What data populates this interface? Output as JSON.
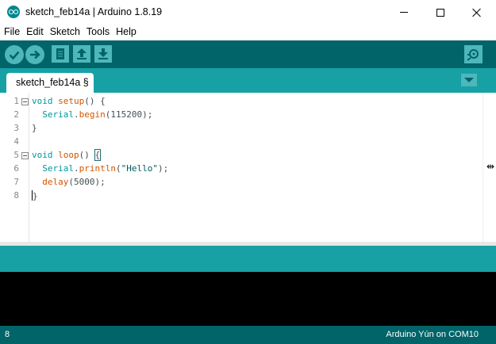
{
  "window": {
    "title": "sketch_feb14a | Arduino 1.8.19",
    "icon": "arduino-logo-icon"
  },
  "menu": [
    "File",
    "Edit",
    "Sketch",
    "Tools",
    "Help"
  ],
  "toolbar": {
    "buttons": [
      "verify-icon",
      "upload-icon",
      "new-icon",
      "open-icon",
      "save-icon"
    ],
    "serial_monitor": "serial-monitor-icon"
  },
  "tab": {
    "label": "sketch_feb14a §"
  },
  "editor": {
    "line_numbers": [
      "1",
      "2",
      "3",
      "4",
      "5",
      "6",
      "7",
      "8"
    ],
    "lines": [
      {
        "tokens": [
          {
            "t": "void",
            "c": "kw"
          },
          {
            "t": " "
          },
          {
            "t": "setup",
            "c": "fn"
          },
          {
            "t": "() {"
          }
        ]
      },
      {
        "tokens": [
          {
            "t": "  "
          },
          {
            "t": "Serial",
            "c": "kw"
          },
          {
            "t": "."
          },
          {
            "t": "begin",
            "c": "fn"
          },
          {
            "t": "(115200);"
          }
        ]
      },
      {
        "tokens": [
          {
            "t": "}"
          }
        ]
      },
      {
        "tokens": []
      },
      {
        "tokens": [
          {
            "t": "void",
            "c": "kw"
          },
          {
            "t": " "
          },
          {
            "t": "loop",
            "c": "fn"
          },
          {
            "t": "() "
          },
          {
            "t": "{",
            "c": "brace-hl"
          }
        ]
      },
      {
        "tokens": [
          {
            "t": "  "
          },
          {
            "t": "Serial",
            "c": "kw"
          },
          {
            "t": "."
          },
          {
            "t": "println",
            "c": "fn"
          },
          {
            "t": "("
          },
          {
            "t": "\"Hello\"",
            "c": "str"
          },
          {
            "t": ");"
          }
        ]
      },
      {
        "tokens": [
          {
            "t": "  "
          },
          {
            "t": "delay",
            "c": "fn"
          },
          {
            "t": "(5000);"
          }
        ]
      },
      {
        "tokens": [
          {
            "t": "}",
            "c": "caret-brace"
          }
        ]
      }
    ]
  },
  "status": {
    "line": "8",
    "board": "Arduino Yún on COM10"
  },
  "colors": {
    "toolbar": "#006468",
    "tabstrip": "#17a1a5",
    "button": "#4db7bb",
    "keyword": "#00979c",
    "function": "#d35400"
  }
}
